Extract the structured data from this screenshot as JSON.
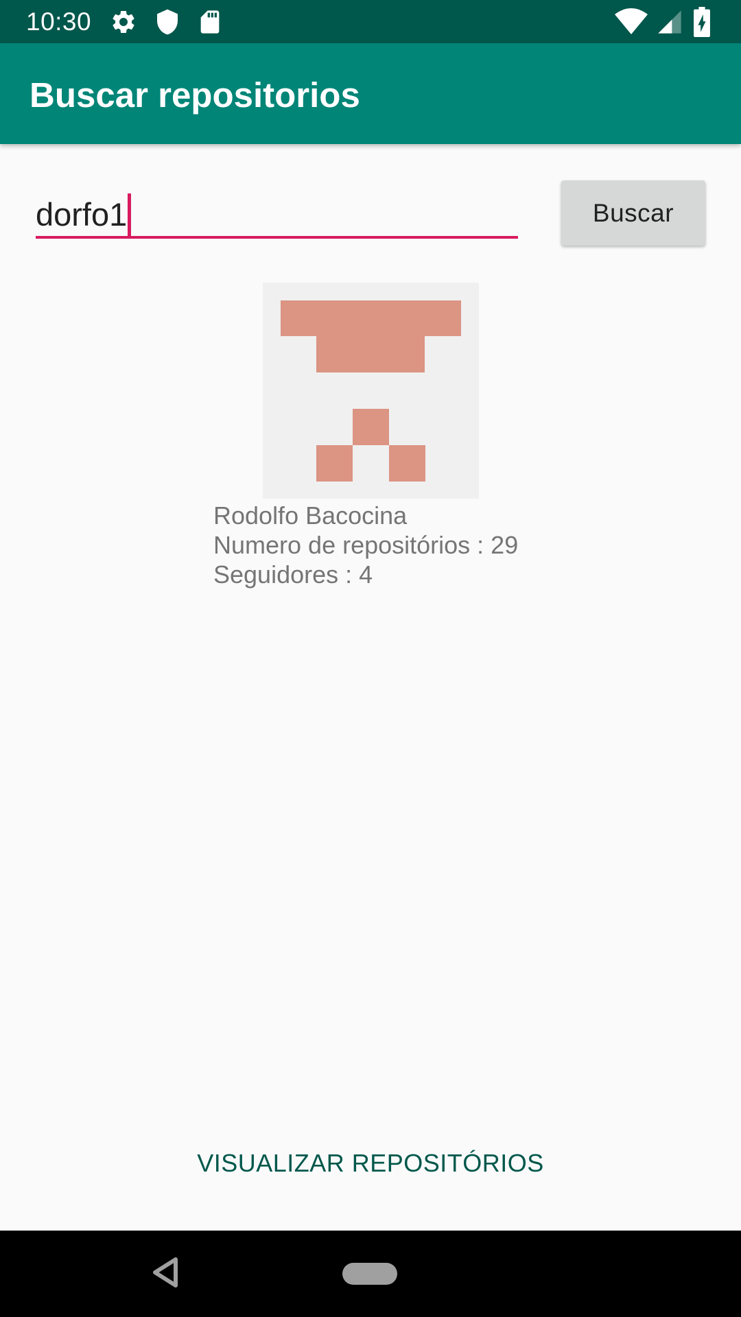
{
  "status_bar": {
    "time": "10:30",
    "left_icons": [
      "gear-icon",
      "shield-icon",
      "sd-card-icon"
    ],
    "right_icons": [
      "wifi-icon",
      "signal-icon",
      "battery-charging-icon"
    ]
  },
  "app_bar": {
    "title": "Buscar repositorios",
    "color": "#008577"
  },
  "search": {
    "value": "dorfo1",
    "underline_color": "#d81b60",
    "button_label": "Buscar"
  },
  "profile": {
    "avatar": "identicon-avatar",
    "name": "Rodolfo Bacocina",
    "repos_text": "Numero de repositórios : 29",
    "followers_text": "Seguidores : 4"
  },
  "actions": {
    "view_repos_label": "VISUALIZAR REPOSITÓRIOS"
  },
  "nav_bar": {
    "icons": [
      "back-icon",
      "home-pill-icon"
    ]
  }
}
